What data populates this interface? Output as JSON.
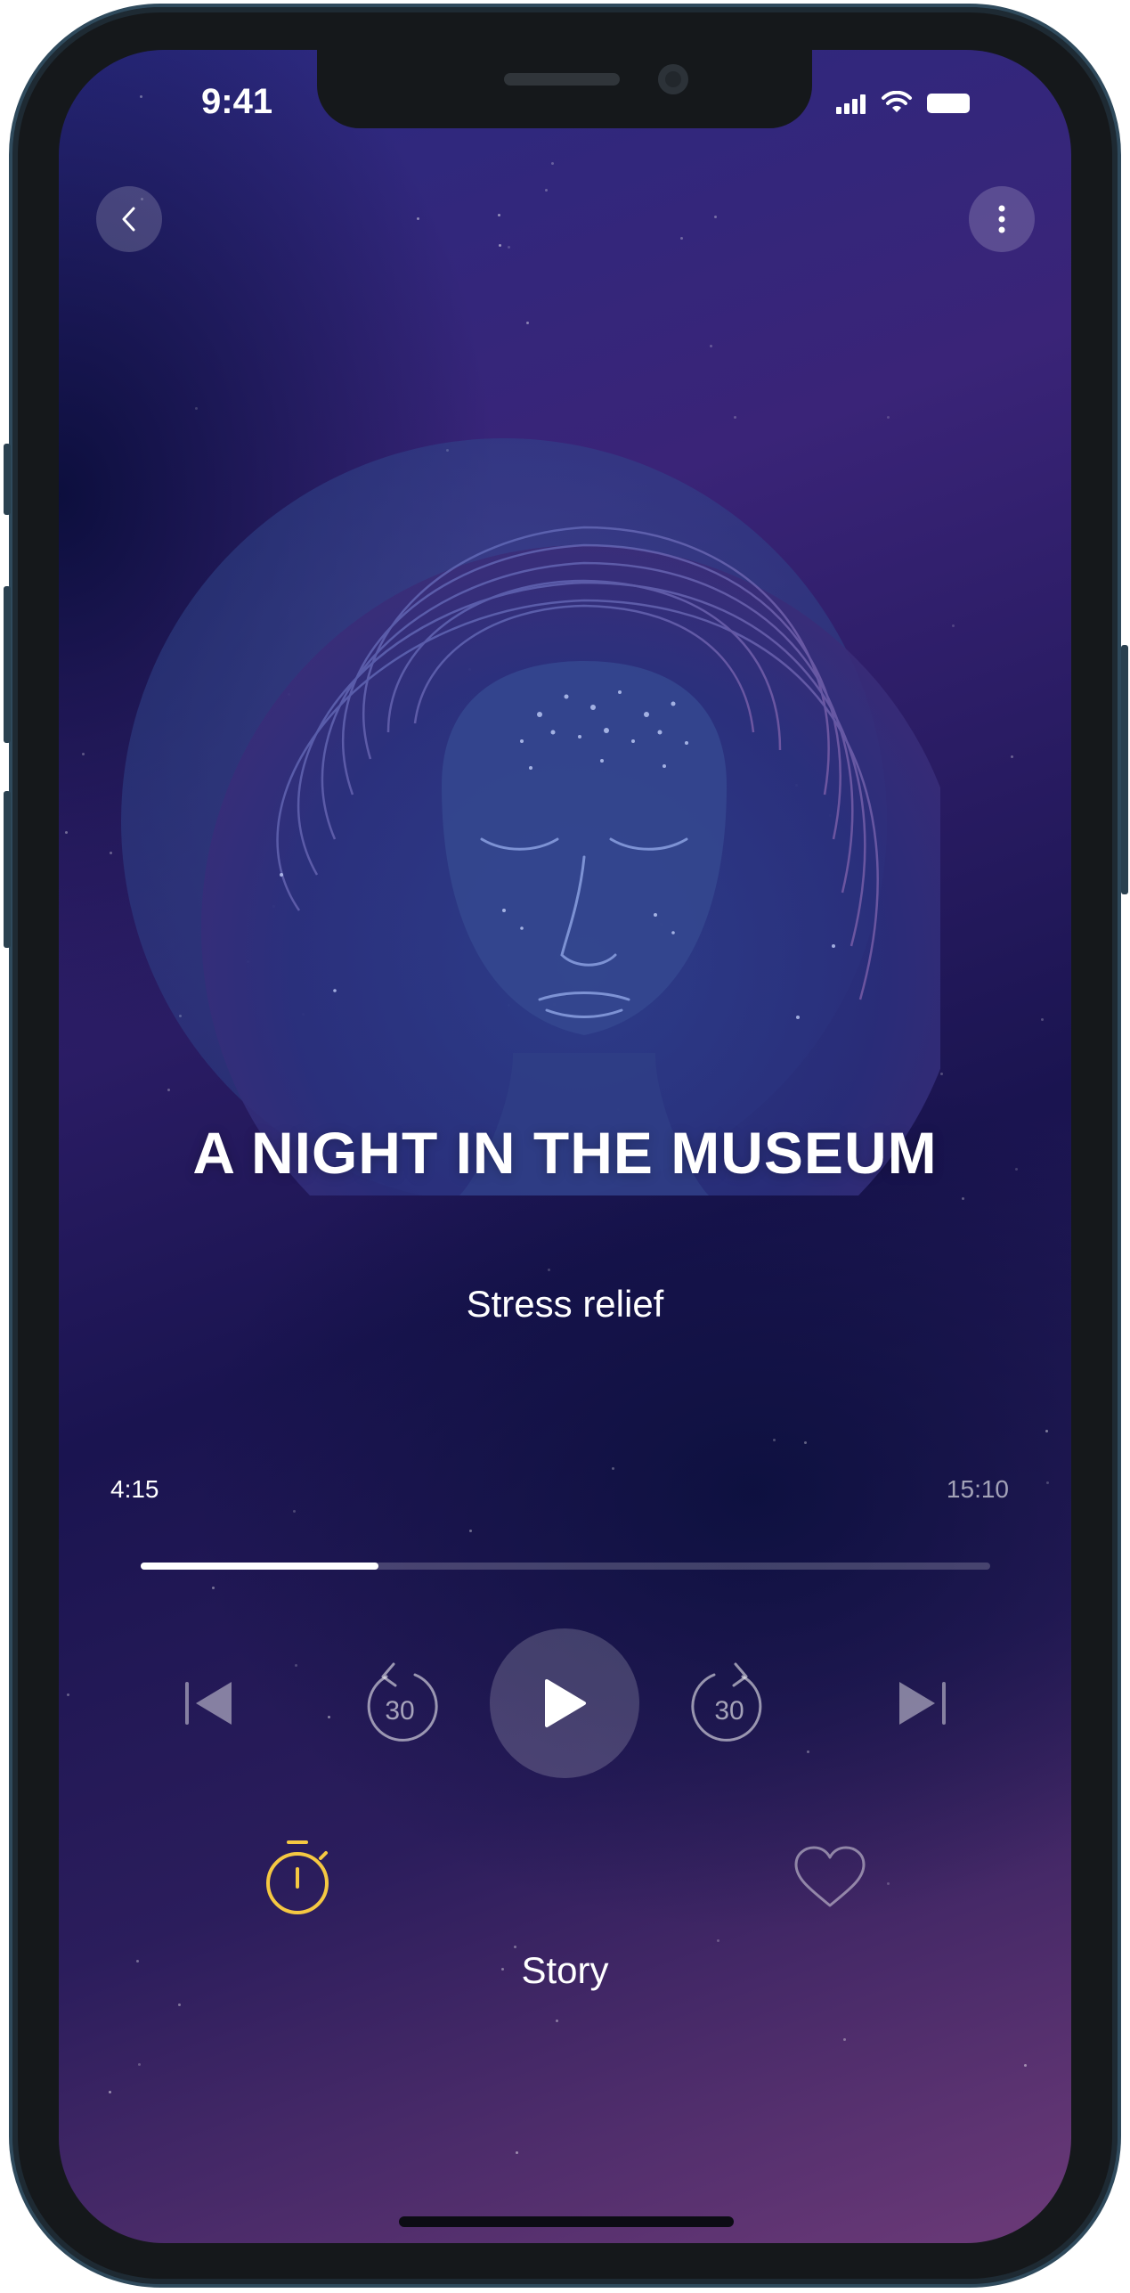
{
  "status_bar": {
    "time": "9:41",
    "icons": [
      "signal-icon",
      "wifi-icon",
      "battery-icon"
    ]
  },
  "header": {
    "back_icon": "chevron-left-icon",
    "menu_icon": "more-vertical-icon"
  },
  "artwork": {
    "description_icon": "meditating-face-artwork"
  },
  "track": {
    "title": "A NIGHT IN THE MUSEUM",
    "subtitle": "Stress relief",
    "category": "Story"
  },
  "player": {
    "elapsed": "4:15",
    "duration": "15:10",
    "progress_fraction": 0.28,
    "rewind_label": "30",
    "forward_label": "30"
  },
  "actions": {
    "timer_icon": "stopwatch-icon",
    "favorite_icon": "heart-icon"
  },
  "colors": {
    "accent": "#F5C842",
    "text": "#FFFFFF"
  }
}
